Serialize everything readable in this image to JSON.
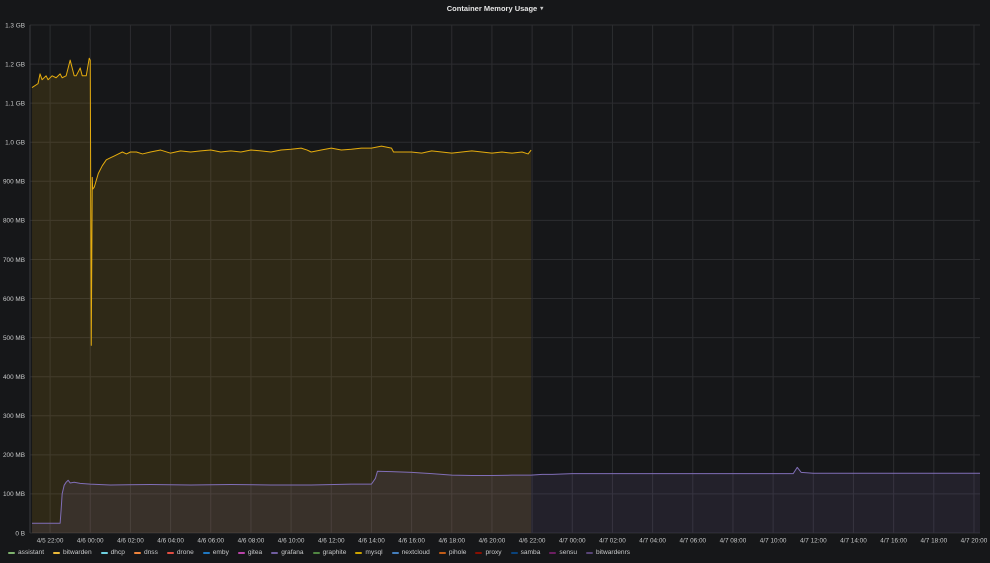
{
  "panel": {
    "title": "Container Memory Usage",
    "menu_icon": "caret-down-icon"
  },
  "chart_data": {
    "type": "area",
    "title": "Container Memory Usage",
    "xlabel": "",
    "ylabel": "",
    "ylim": [
      0,
      1.3
    ],
    "y_unit": "GB",
    "y_ticks": [
      {
        "value": 0,
        "label": "0 B"
      },
      {
        "value": 0.1,
        "label": "100 MB"
      },
      {
        "value": 0.2,
        "label": "200 MB"
      },
      {
        "value": 0.3,
        "label": "300 MB"
      },
      {
        "value": 0.4,
        "label": "400 MB"
      },
      {
        "value": 0.5,
        "label": "500 MB"
      },
      {
        "value": 0.6,
        "label": "600 MB"
      },
      {
        "value": 0.7,
        "label": "700 MB"
      },
      {
        "value": 0.8,
        "label": "800 MB"
      },
      {
        "value": 0.9,
        "label": "900 MB"
      },
      {
        "value": 1.0,
        "label": "1.0 GB"
      },
      {
        "value": 1.1,
        "label": "1.1 GB"
      },
      {
        "value": 1.2,
        "label": "1.2 GB"
      },
      {
        "value": 1.3,
        "label": "1.3 GB"
      }
    ],
    "x_unit": "hours since 4/5 21:00",
    "xlim": [
      0,
      47.3
    ],
    "x_ticks": [
      {
        "value": 1,
        "label": "4/5 22:00"
      },
      {
        "value": 3,
        "label": "4/6 00:00"
      },
      {
        "value": 5,
        "label": "4/6 02:00"
      },
      {
        "value": 7,
        "label": "4/6 04:00"
      },
      {
        "value": 9,
        "label": "4/6 06:00"
      },
      {
        "value": 11,
        "label": "4/6 08:00"
      },
      {
        "value": 13,
        "label": "4/6 10:00"
      },
      {
        "value": 15,
        "label": "4/6 12:00"
      },
      {
        "value": 17,
        "label": "4/6 14:00"
      },
      {
        "value": 19,
        "label": "4/6 16:00"
      },
      {
        "value": 21,
        "label": "4/6 18:00"
      },
      {
        "value": 23,
        "label": "4/6 20:00"
      },
      {
        "value": 25,
        "label": "4/6 22:00"
      },
      {
        "value": 27,
        "label": "4/7 00:00"
      },
      {
        "value": 29,
        "label": "4/7 02:00"
      },
      {
        "value": 31,
        "label": "4/7 04:00"
      },
      {
        "value": 33,
        "label": "4/7 06:00"
      },
      {
        "value": 35,
        "label": "4/7 08:00"
      },
      {
        "value": 37,
        "label": "4/7 10:00"
      },
      {
        "value": 39,
        "label": "4/7 12:00"
      },
      {
        "value": 41,
        "label": "4/7 14:00"
      },
      {
        "value": 43,
        "label": "4/7 16:00"
      },
      {
        "value": 45,
        "label": "4/7 18:00"
      },
      {
        "value": 47,
        "label": "4/7 20:00"
      }
    ],
    "grid": true,
    "legend_placement": "bottom-left",
    "series": [
      {
        "name": "mysql",
        "color": "#e5ac0e",
        "x": [
          0.1,
          0.4,
          0.5,
          0.6,
          0.8,
          0.9,
          1.1,
          1.3,
          1.5,
          1.6,
          1.8,
          2.0,
          2.2,
          2.3,
          2.5,
          2.6,
          2.8,
          2.9,
          2.95,
          3.0,
          3.05,
          3.1,
          3.12,
          3.2,
          3.4,
          3.6,
          3.8,
          4.0,
          4.2,
          4.4,
          4.6,
          4.8,
          5.0,
          5.3,
          5.6,
          6.0,
          6.5,
          7.0,
          7.5,
          8.0,
          8.5,
          9.0,
          9.5,
          10.0,
          10.5,
          11.0,
          11.5,
          12.0,
          12.5,
          13.0,
          13.5,
          13.8,
          14.0,
          14.5,
          15.0,
          15.5,
          16.0,
          16.5,
          17.0,
          17.5,
          18.0,
          18.1,
          18.5,
          19.0,
          19.5,
          20.0,
          20.5,
          21.0,
          21.5,
          22.0,
          22.5,
          23.0,
          23.5,
          24.0,
          24.5,
          24.8,
          24.95
        ],
        "values": [
          1.14,
          1.15,
          1.175,
          1.16,
          1.17,
          1.16,
          1.17,
          1.165,
          1.175,
          1.165,
          1.17,
          1.21,
          1.17,
          1.17,
          1.19,
          1.17,
          1.17,
          1.2,
          1.215,
          1.21,
          0.48,
          0.91,
          0.88,
          0.885,
          0.92,
          0.94,
          0.955,
          0.96,
          0.965,
          0.97,
          0.975,
          0.97,
          0.975,
          0.975,
          0.97,
          0.975,
          0.98,
          0.972,
          0.978,
          0.975,
          0.978,
          0.98,
          0.975,
          0.978,
          0.975,
          0.98,
          0.978,
          0.975,
          0.98,
          0.982,
          0.985,
          0.98,
          0.975,
          0.98,
          0.985,
          0.98,
          0.982,
          0.985,
          0.985,
          0.99,
          0.985,
          0.975,
          0.975,
          0.975,
          0.972,
          0.978,
          0.975,
          0.972,
          0.975,
          0.978,
          0.975,
          0.972,
          0.975,
          0.972,
          0.975,
          0.97,
          0.98
        ]
      },
      {
        "name": "bitwardenrs",
        "color": "#806eb7",
        "x": [
          0.1,
          1.5,
          1.55,
          1.6,
          1.7,
          1.8,
          1.9,
          2.0,
          2.2,
          2.5,
          3.0,
          4.0,
          6.0,
          8.0,
          10.0,
          12.0,
          14.0,
          16.0,
          17.0,
          17.2,
          17.3,
          18.0,
          19.0,
          20.0,
          21.0,
          22.0,
          23.0,
          24.0,
          24.95,
          25.5,
          26.0,
          27.0,
          29.0,
          31.0,
          33.0,
          35.0,
          37.0,
          38.0,
          38.2,
          38.4,
          39.0,
          41.0,
          43.0,
          45.0,
          47.3
        ],
        "values": [
          0.025,
          0.025,
          0.06,
          0.1,
          0.122,
          0.13,
          0.135,
          0.128,
          0.13,
          0.127,
          0.125,
          0.123,
          0.124,
          0.123,
          0.124,
          0.123,
          0.123,
          0.125,
          0.125,
          0.14,
          0.158,
          0.157,
          0.155,
          0.152,
          0.148,
          0.147,
          0.147,
          0.148,
          0.148,
          0.15,
          0.15,
          0.152,
          0.152,
          0.152,
          0.152,
          0.152,
          0.152,
          0.152,
          0.168,
          0.155,
          0.153,
          0.153,
          0.153,
          0.153,
          0.153
        ]
      }
    ],
    "legend": [
      {
        "name": "assistant",
        "color": "#7eb26d"
      },
      {
        "name": "bitwarden",
        "color": "#eab839"
      },
      {
        "name": "dhcp",
        "color": "#6ed0e0"
      },
      {
        "name": "dnss",
        "color": "#ef843c"
      },
      {
        "name": "drone",
        "color": "#e24d42"
      },
      {
        "name": "emby",
        "color": "#1f78c1"
      },
      {
        "name": "gitea",
        "color": "#ba43a9"
      },
      {
        "name": "grafana",
        "color": "#705da0"
      },
      {
        "name": "graphite",
        "color": "#508642"
      },
      {
        "name": "mysql",
        "color": "#cca300"
      },
      {
        "name": "nextcloud",
        "color": "#447ebc"
      },
      {
        "name": "pihole",
        "color": "#c15c17"
      },
      {
        "name": "proxy",
        "color": "#890f02"
      },
      {
        "name": "samba",
        "color": "#0a437c"
      },
      {
        "name": "sensu",
        "color": "#6d1f62"
      },
      {
        "name": "bitwardenrs",
        "color": "#584477"
      }
    ]
  }
}
